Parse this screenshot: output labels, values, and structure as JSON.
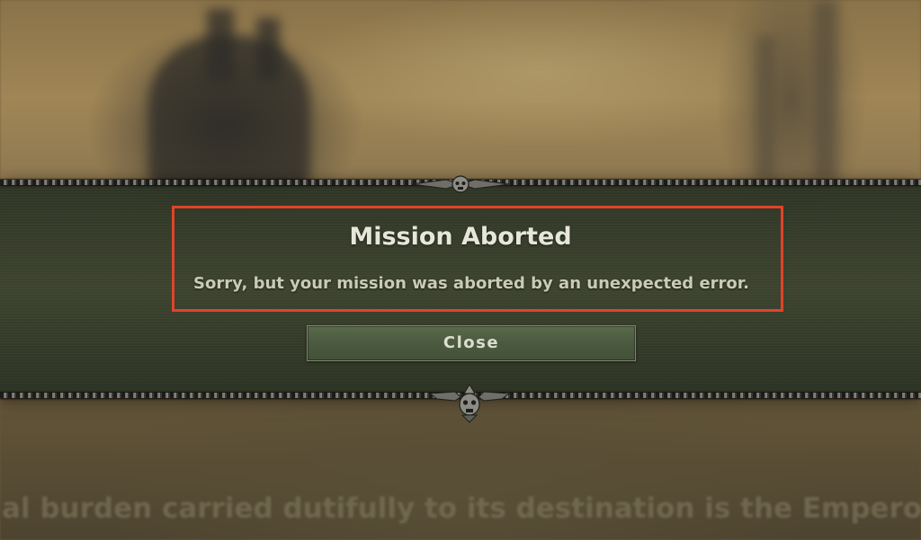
{
  "background": {
    "subtitle_text": "al burden carried dutifully to its destination is the Emperor's grea"
  },
  "dialog": {
    "title": "Mission Aborted",
    "message": "Sorry, but your mission was aborted by an unexpected error.",
    "close_label": "Close"
  },
  "colors": {
    "highlight": "#e0432a",
    "panel": "#37402c",
    "button": "#4b5a3f",
    "title_text": "#e6e6da"
  },
  "icons": {
    "top_ornament": "winged-skull-icon",
    "bottom_ornament": "winged-skull-icon"
  }
}
